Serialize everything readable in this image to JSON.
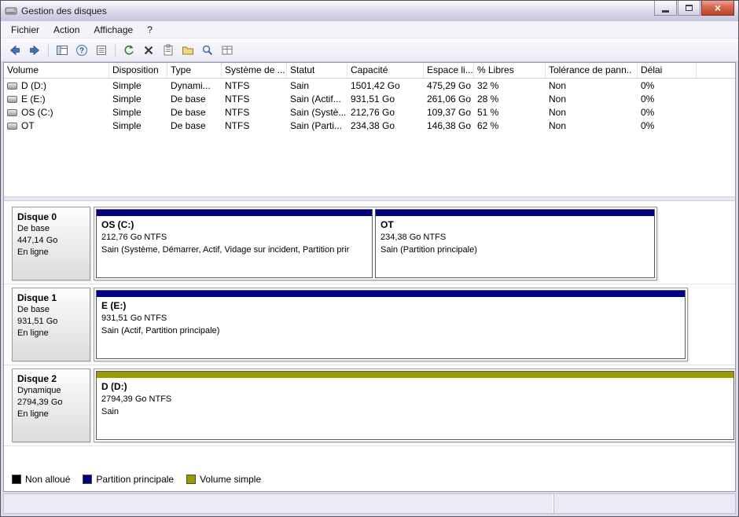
{
  "window": {
    "title": "Gestion des disques"
  },
  "menu": {
    "items": [
      {
        "label": "Fichier"
      },
      {
        "label": "Action"
      },
      {
        "label": "Affichage"
      },
      {
        "label": "?"
      }
    ]
  },
  "toolbar": {
    "icons": [
      "back",
      "forward",
      "show-console-tree",
      "help",
      "export-list",
      "refresh",
      "delete",
      "properties",
      "open-folder",
      "rescan-disks",
      "grid-view"
    ]
  },
  "volume_table": {
    "columns": [
      "Volume",
      "Disposition",
      "Type",
      "Système de ...",
      "Statut",
      "Capacité",
      "Espace li...",
      "% Libres",
      "Tolérance de pann..",
      "Délai"
    ],
    "rows": [
      {
        "volume": "D (D:)",
        "disposition": "Simple",
        "type": "Dynami...",
        "fs": "NTFS",
        "statut": "Sain",
        "capacite": "1501,42 Go",
        "espace": "475,29 Go",
        "libres": "32 %",
        "tolerance": "Non",
        "delai": "0%"
      },
      {
        "volume": "E (E:)",
        "disposition": "Simple",
        "type": "De base",
        "fs": "NTFS",
        "statut": "Sain (Actif...",
        "capacite": "931,51 Go",
        "espace": "261,06 Go",
        "libres": "28 %",
        "tolerance": "Non",
        "delai": "0%"
      },
      {
        "volume": "OS (C:)",
        "disposition": "Simple",
        "type": "De base",
        "fs": "NTFS",
        "statut": "Sain (Systè...",
        "capacite": "212,76 Go",
        "espace": "109,37 Go",
        "libres": "51 %",
        "tolerance": "Non",
        "delai": "0%"
      },
      {
        "volume": "OT",
        "disposition": "Simple",
        "type": "De base",
        "fs": "NTFS",
        "statut": "Sain (Parti...",
        "capacite": "234,38 Go",
        "espace": "146,38 Go",
        "libres": "62 %",
        "tolerance": "Non",
        "delai": "0%"
      }
    ]
  },
  "disk_graph": {
    "disks": [
      {
        "name": "Disque 0",
        "type": "De base",
        "size": "447,14 Go",
        "status": "En ligne",
        "partitions": [
          {
            "title": "OS  (C:)",
            "info": "212,76 Go NTFS",
            "status": "Sain (Système, Démarrer, Actif, Vidage sur incident, Partition prir",
            "color": "#000080"
          },
          {
            "title": "OT",
            "info": "234,38 Go NTFS",
            "status": "Sain (Partition principale)",
            "color": "#000080"
          }
        ]
      },
      {
        "name": "Disque 1",
        "type": "De base",
        "size": "931,51 Go",
        "status": "En ligne",
        "partitions": [
          {
            "title": "E  (E:)",
            "info": "931,51 Go NTFS",
            "status": "Sain (Actif, Partition principale)",
            "color": "#000080"
          }
        ]
      },
      {
        "name": "Disque 2",
        "type": "Dynamique",
        "size": "2794,39 Go",
        "status": "En ligne",
        "partitions": [
          {
            "title": "D  (D:)",
            "info": "2794,39 Go NTFS",
            "status": "Sain",
            "color": "#999900"
          }
        ]
      }
    ]
  },
  "legend": {
    "items": [
      {
        "label": "Non alloué",
        "color": "#000000"
      },
      {
        "label": "Partition principale",
        "color": "#000080"
      },
      {
        "label": "Volume simple",
        "color": "#999900"
      }
    ]
  }
}
